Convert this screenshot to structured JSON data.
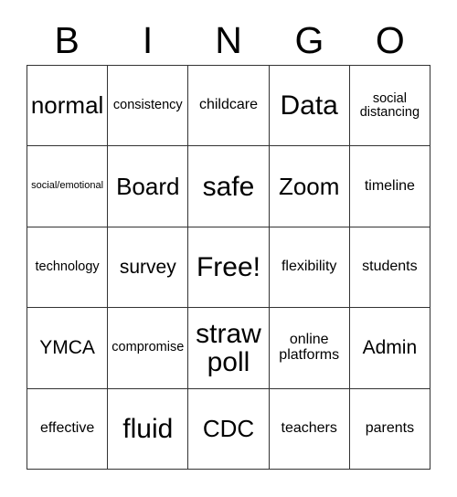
{
  "header": {
    "letters": [
      "B",
      "I",
      "N",
      "G",
      "O"
    ]
  },
  "grid": {
    "rows": 5,
    "columns": 5,
    "border_color": "#333333",
    "background_color": "#ffffff",
    "text_color": "#000000",
    "cells": [
      {
        "text": "normal",
        "size": "xl",
        "row": 1,
        "col": 1
      },
      {
        "text": "consistency",
        "size": "sm",
        "row": 1,
        "col": 2
      },
      {
        "text": "childcare",
        "size": "md",
        "row": 1,
        "col": 3
      },
      {
        "text": "Data",
        "size": "xxl",
        "row": 1,
        "col": 4
      },
      {
        "text": "social\ndistancing",
        "size": "sm",
        "row": 1,
        "col": 5
      },
      {
        "text": "social/emotional",
        "size": "xs",
        "row": 2,
        "col": 1
      },
      {
        "text": "Board",
        "size": "xl",
        "row": 2,
        "col": 2
      },
      {
        "text": "safe",
        "size": "xxl",
        "row": 2,
        "col": 3
      },
      {
        "text": "Zoom",
        "size": "xl",
        "row": 2,
        "col": 4
      },
      {
        "text": "timeline",
        "size": "md",
        "row": 2,
        "col": 5
      },
      {
        "text": "technology",
        "size": "sm",
        "row": 3,
        "col": 1
      },
      {
        "text": "survey",
        "size": "lg",
        "row": 3,
        "col": 2
      },
      {
        "text": "Free!",
        "size": "xxl",
        "row": 3,
        "col": 3
      },
      {
        "text": "flexibility",
        "size": "md",
        "row": 3,
        "col": 4
      },
      {
        "text": "students",
        "size": "md",
        "row": 3,
        "col": 5
      },
      {
        "text": "YMCA",
        "size": "lg",
        "row": 4,
        "col": 1
      },
      {
        "text": "compromise",
        "size": "sm",
        "row": 4,
        "col": 2
      },
      {
        "text": "straw\npoll",
        "size": "xxl",
        "row": 4,
        "col": 3
      },
      {
        "text": "online\nplatforms",
        "size": "md",
        "row": 4,
        "col": 4
      },
      {
        "text": "Admin",
        "size": "lg",
        "row": 4,
        "col": 5
      },
      {
        "text": "effective",
        "size": "md",
        "row": 5,
        "col": 1
      },
      {
        "text": "fluid",
        "size": "xxl",
        "row": 5,
        "col": 2
      },
      {
        "text": "CDC",
        "size": "xl",
        "row": 5,
        "col": 3
      },
      {
        "text": "teachers",
        "size": "md",
        "row": 5,
        "col": 4
      },
      {
        "text": "parents",
        "size": "md",
        "row": 5,
        "col": 5
      }
    ]
  }
}
